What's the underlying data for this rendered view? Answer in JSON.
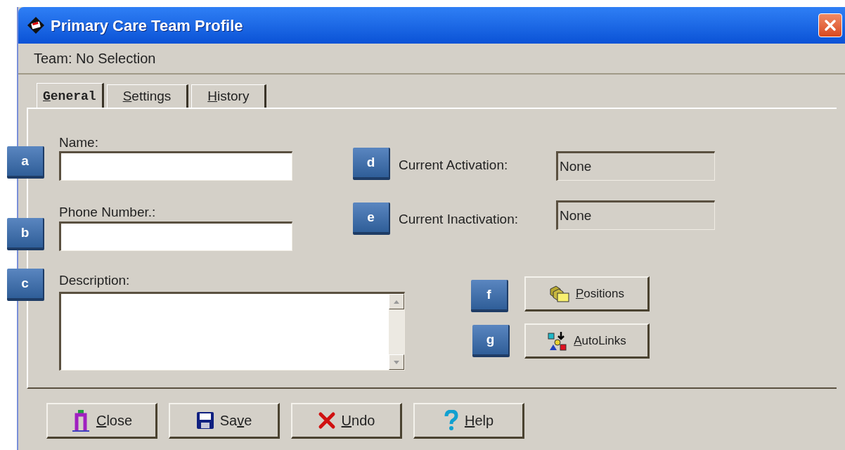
{
  "window": {
    "title": "Primary Care Team Profile"
  },
  "header": {
    "text": "Team: No Selection"
  },
  "tabs": [
    {
      "hotkey": "G",
      "label_rest": "eneral",
      "selected": true
    },
    {
      "hotkey": "S",
      "label_rest": "ettings",
      "selected": false
    },
    {
      "hotkey": "H",
      "label_rest": "istory",
      "selected": false
    }
  ],
  "form": {
    "name": {
      "label": "Name:"
    },
    "phone": {
      "label": "Phone Number.:"
    },
    "description": {
      "label": "Description:"
    },
    "activation": {
      "label": "Current Activation:",
      "value": "None"
    },
    "inactivation": {
      "label": "Current Inactivation:",
      "value": "None"
    }
  },
  "side_buttons": [
    {
      "hotkey": "P",
      "label_rest": "ositions",
      "kind": "positions"
    },
    {
      "hotkey": "A",
      "label_rest": "utoLinks",
      "kind": "autolinks"
    }
  ],
  "footer_buttons": [
    {
      "hotkey": "C",
      "label_rest": "lose",
      "kind": "close"
    },
    {
      "label_start": "Sa",
      "hotkey": "v",
      "label_rest": "e",
      "kind": "save"
    },
    {
      "hotkey": "U",
      "label_rest": "ndo",
      "kind": "undo"
    },
    {
      "hotkey": "H",
      "label_rest": "elp",
      "kind": "help"
    }
  ],
  "callouts": [
    {
      "letter": "a"
    },
    {
      "letter": "b"
    },
    {
      "letter": "c"
    },
    {
      "letter": "d"
    },
    {
      "letter": "e"
    },
    {
      "letter": "f"
    },
    {
      "letter": "g"
    }
  ]
}
